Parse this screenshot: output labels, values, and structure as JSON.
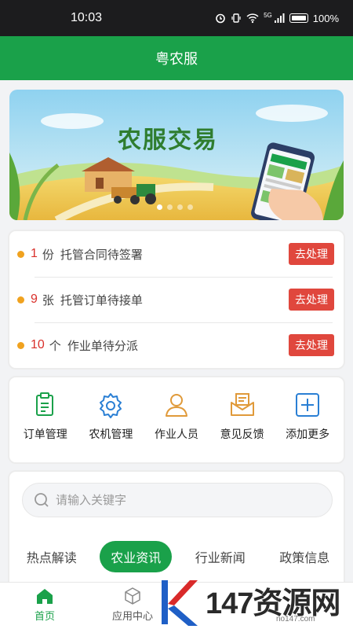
{
  "status_bar": {
    "time": "10:03",
    "network": "5G",
    "battery": "100%"
  },
  "header": {
    "title": "粤农服"
  },
  "banner": {
    "title": "农服交易",
    "phone_label": "农服交易",
    "pages": 4,
    "active_page": 1
  },
  "todos": [
    {
      "count": "1",
      "unit": "份",
      "text": "托管合同待签署",
      "button": "去处理"
    },
    {
      "count": "9",
      "unit": "张",
      "text": "托管订单待接单",
      "button": "去处理"
    },
    {
      "count": "10",
      "unit": "个",
      "text": "作业单待分派",
      "button": "去处理"
    }
  ],
  "menu": [
    {
      "label": "订单管理",
      "icon": "clipboard-icon",
      "color": "#1aa14a"
    },
    {
      "label": "农机管理",
      "icon": "gear-icon",
      "color": "#2a7fd4"
    },
    {
      "label": "作业人员",
      "icon": "person-icon",
      "color": "#e09a3a"
    },
    {
      "label": "意见反馈",
      "icon": "mail-icon",
      "color": "#e09a3a"
    },
    {
      "label": "添加更多",
      "icon": "plus-square-icon",
      "color": "#2a7fd4"
    }
  ],
  "search": {
    "placeholder": "请输入关键字",
    "value": ""
  },
  "news_tabs": [
    {
      "label": "热点解读",
      "active": false
    },
    {
      "label": "农业资讯",
      "active": true
    },
    {
      "label": "行业新闻",
      "active": false
    },
    {
      "label": "政策信息",
      "active": false
    }
  ],
  "bottom_nav": [
    {
      "label": "首页",
      "icon": "home-icon",
      "active": true
    },
    {
      "label": "应用中心",
      "icon": "cube-icon",
      "active": false
    }
  ],
  "watermark": {
    "text": "147资源网",
    "url": "no147.com"
  },
  "colors": {
    "primary": "#1aa14a",
    "alert": "#e0473d",
    "dot": "#f0a21f",
    "count": "#d9302b"
  }
}
